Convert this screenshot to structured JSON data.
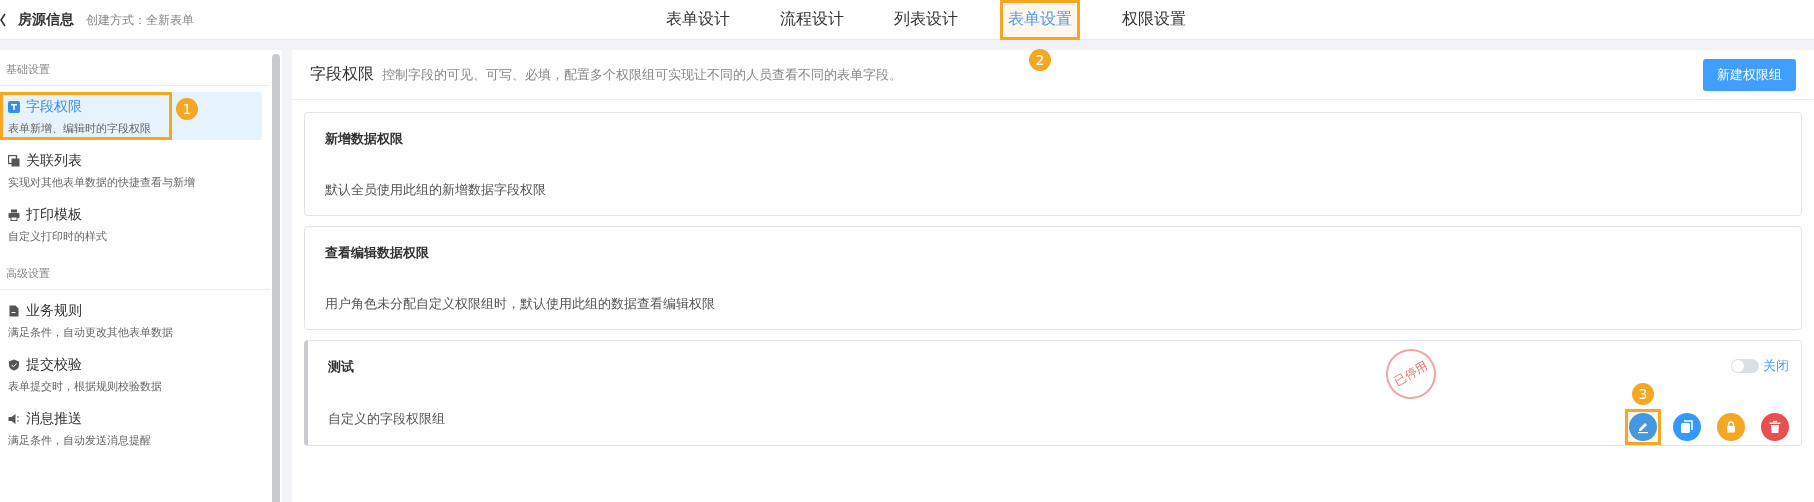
{
  "header": {
    "title": "房源信息",
    "subtitle": "创建方式：全新表单"
  },
  "tabs": [
    {
      "label": "表单设计",
      "selected": false
    },
    {
      "label": "流程设计",
      "selected": false
    },
    {
      "label": "列表设计",
      "selected": false
    },
    {
      "label": "表单设置",
      "selected": true,
      "annotation": "2"
    },
    {
      "label": "权限设置",
      "selected": false
    }
  ],
  "sidebar": {
    "sections": [
      {
        "title": "基础设置",
        "items": [
          {
            "kind": "text",
            "title": "字段权限",
            "desc": "表单新增、编辑时的字段权限",
            "selected": true,
            "annotation": "1"
          },
          {
            "kind": "copy",
            "title": "关联列表",
            "desc": "实现对其他表单数据的快捷查看与新增",
            "selected": false
          },
          {
            "kind": "printer",
            "title": "打印模板",
            "desc": "自定义打印时的样式",
            "selected": false
          }
        ]
      },
      {
        "title": "高级设置",
        "items": [
          {
            "kind": "file",
            "title": "业务规则",
            "desc": "满足条件，自动更改其他表单数据",
            "selected": false
          },
          {
            "kind": "shield",
            "title": "提交校验",
            "desc": "表单提交时，根据规则校验数据",
            "selected": false
          },
          {
            "kind": "speaker",
            "title": "消息推送",
            "desc": "满足条件，自动发送消息提醒",
            "selected": false
          }
        ]
      }
    ]
  },
  "panel": {
    "title": "字段权限",
    "desc": "控制字段的可见、可写、必填，配置多个权限组可实现让不同的人员查看不同的表单字段。",
    "button": "新建权限组",
    "cards": [
      {
        "title": "新增数据权限",
        "desc": "默认全员使用此组的新增数据字段权限"
      },
      {
        "title": "查看编辑数据权限",
        "desc": "用户角色未分配自定义权限组时，默认使用此组的数据查看编辑权限"
      },
      {
        "title": "测试",
        "desc": "自定义的字段权限组",
        "custom": true,
        "stamp": "已停用",
        "toggle": {
          "on": false,
          "label": "关闭"
        },
        "actions": [
          {
            "kind": "edit",
            "color": "#4299e1",
            "annotation": "3"
          },
          {
            "kind": "copy",
            "color": "#3399ff"
          },
          {
            "kind": "lock",
            "color": "#f5a623"
          },
          {
            "kind": "delete",
            "color": "#e94f4f"
          }
        ]
      }
    ]
  }
}
